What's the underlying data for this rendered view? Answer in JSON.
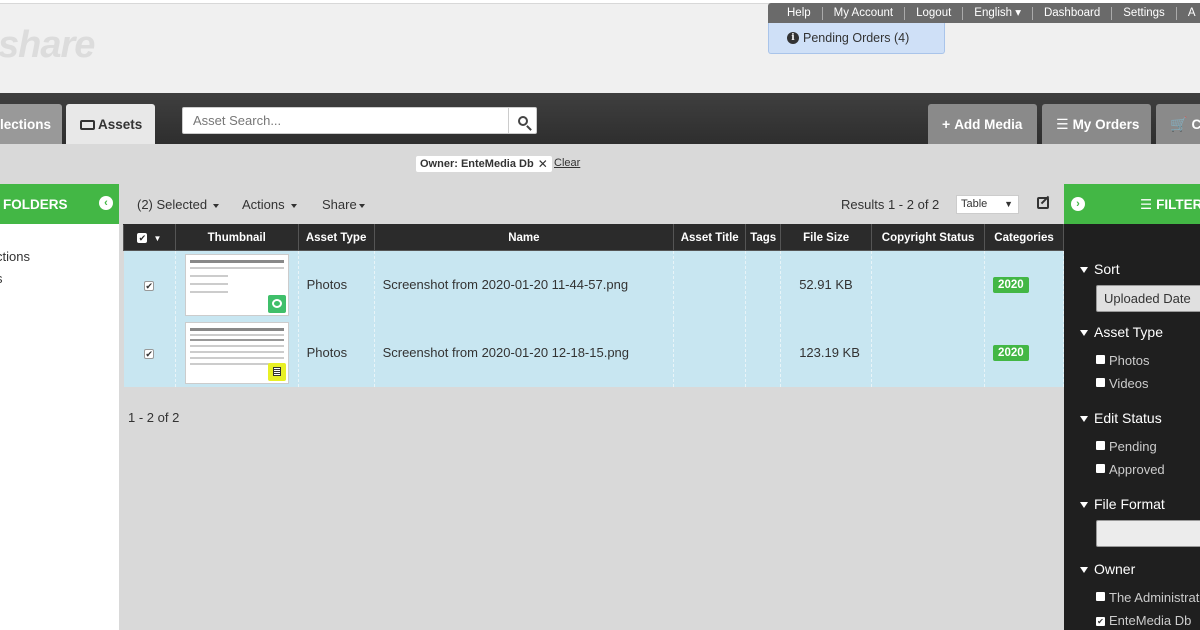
{
  "logo_text": "share",
  "topnav": {
    "items": [
      "Help",
      "My Account",
      "Logout",
      "English ▾",
      "Dashboard",
      "Settings",
      "A"
    ]
  },
  "pending_orders": "Pending Orders (4)",
  "nav": {
    "collections_tab": "lections",
    "assets_tab": "Assets",
    "search_placeholder": "Asset Search...",
    "add_media": "Add Media",
    "my_orders": "My Orders",
    "cart": "Ca"
  },
  "filter_chip": {
    "label": "Owner: EnteMedia Db",
    "close": "✕",
    "clear": "Clear"
  },
  "left_sidebar": {
    "title": "FOLDERS",
    "items": [
      "ctions",
      "s"
    ]
  },
  "toolbar": {
    "selected": "(2) Selected",
    "actions": "Actions",
    "share": "Share",
    "results": "Results 1 - 2 of 2",
    "view": "Table"
  },
  "table": {
    "headers": [
      "Thumbnail",
      "Asset Type",
      "Name",
      "Asset Title",
      "Tags",
      "File Size",
      "Copyright Status",
      "Categories"
    ],
    "rows": [
      {
        "type": "Photos",
        "name": "Screenshot from 2020-01-20 11-44-57.png",
        "title": "",
        "tags": "",
        "size": "52.91 KB",
        "copyright": "",
        "category": "2020"
      },
      {
        "type": "Photos",
        "name": "Screenshot from 2020-01-20 12-18-15.png",
        "title": "",
        "tags": "",
        "size": "123.19 KB",
        "copyright": "",
        "category": "2020"
      }
    ]
  },
  "pagination": "1 - 2 of 2",
  "right_sidebar": {
    "title": "FILTER",
    "sort": {
      "label": "Sort",
      "value": "Uploaded Date"
    },
    "asset_type": {
      "label": "Asset Type",
      "options": [
        "Photos",
        "Videos"
      ]
    },
    "edit_status": {
      "label": "Edit Status",
      "options": [
        "Pending",
        "Approved"
      ]
    },
    "file_format": {
      "label": "File Format",
      "value": ""
    },
    "owner": {
      "label": "Owner",
      "options": [
        "The Administrato",
        "EnteMedia Db"
      ]
    }
  },
  "colors": {
    "accent_green": "#43b745",
    "selected_row": "#c8e6f1",
    "header_dark": "#2b2b2b"
  }
}
